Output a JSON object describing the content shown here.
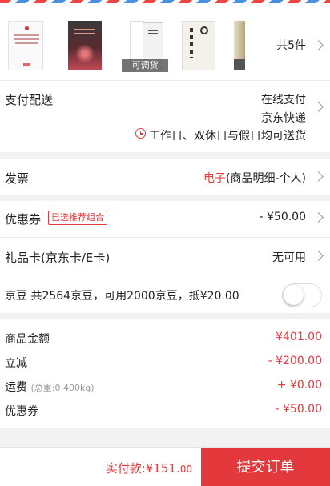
{
  "products": {
    "items": [
      {
        "name": "book-cover-1",
        "badge": ""
      },
      {
        "name": "book-cover-2",
        "badge": ""
      },
      {
        "name": "book-cover-3",
        "badge": "可调货"
      },
      {
        "name": "book-cover-4",
        "badge": ""
      },
      {
        "name": "book-cover-5",
        "badge": ""
      }
    ],
    "count_text": "共5件"
  },
  "delivery": {
    "label": "支付配送",
    "payment": "在线支付",
    "shipping": "京东快递",
    "schedule": "工作日、双休日与假日均可送货",
    "icon": "clock-icon"
  },
  "invoice": {
    "label": "发票",
    "type_prefix": "电子",
    "type_rest": "(商品明细-个人)"
  },
  "coupon": {
    "label": "优惠券",
    "tag": "已选推荐组合",
    "value": "- ¥50.00"
  },
  "gift_card": {
    "label": "礼品卡(京东卡/E卡)",
    "value": "无可用"
  },
  "jd_beans": {
    "text": "京豆  共2564京豆，可用2000京豆，抵¥20.00",
    "enabled": false
  },
  "summary": {
    "goods_label": "商品金额",
    "goods_value": "¥401.00",
    "discount_label": "立减",
    "discount_value": "- ¥200.00",
    "shipping_label": "运费",
    "shipping_sub": "(总重:0.400kg)",
    "shipping_value": "+ ¥0.00",
    "coupon_label": "优惠券",
    "coupon_value": "- ¥50.00"
  },
  "footer": {
    "pay_label": "实付款:",
    "pay_main": "¥151.",
    "pay_cents": "00",
    "submit": "提交订单"
  },
  "colors": {
    "accent": "#e4393c",
    "background": "#f2f2f2"
  }
}
